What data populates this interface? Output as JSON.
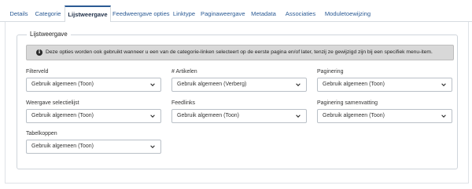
{
  "tabs": [
    {
      "label": "Details"
    },
    {
      "label": "Categorie"
    },
    {
      "label": "Lijstweergave",
      "active": true
    },
    {
      "label": "Feedweergave opties"
    },
    {
      "label": "Linktype"
    },
    {
      "label": "Paginaweergave"
    },
    {
      "label": "Metadata"
    },
    {
      "label": "Associaties"
    },
    {
      "label": "Moduletoewijzing"
    }
  ],
  "fieldset": {
    "legend": "Lijstweergave"
  },
  "alert": {
    "icon": "info-icon",
    "text": "Deze opties worden ook gebruikt wanneer u een van de categorie-linken selecteert op de eerste pagina en/of later, tenzij ze gewijzigd zijn bij een specifiek menu-item."
  },
  "fields": {
    "filterveld": {
      "label": "Filterveld",
      "value": "Gebruik algemeen (Toon)"
    },
    "artikelen": {
      "label": "# Artikelen",
      "value": "Gebruik algemeen (Verberg)"
    },
    "paginering": {
      "label": "Paginering",
      "value": "Gebruik algemeen (Toon)"
    },
    "weergave_selectielijst": {
      "label": "Weergave selectielijst",
      "value": "Gebruik algemeen (Toon)"
    },
    "feedlinks": {
      "label": "Feedlinks",
      "value": "Gebruik algemeen (Toon)"
    },
    "paginering_samenvatting": {
      "label": "Paginering samenvatting",
      "value": "Gebruik algemeen (Toon)"
    },
    "tabelkoppen": {
      "label": "Tabelkoppen",
      "value": "Gebruik algemeen (Toon)"
    }
  },
  "colors": {
    "accent": "#2a5a94",
    "alert_bg": "#d8d8d8",
    "border": "#b9c0c7"
  }
}
